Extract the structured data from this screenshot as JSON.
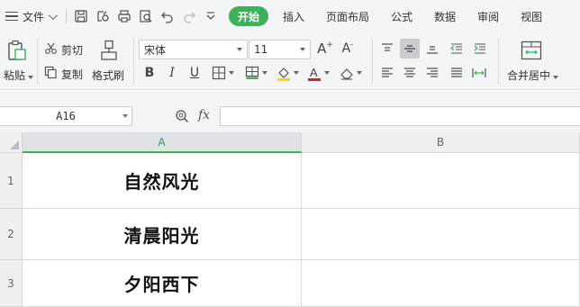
{
  "menu": {
    "file_label": "文件",
    "tabs": [
      "开始",
      "插入",
      "页面布局",
      "公式",
      "数据",
      "审阅",
      "视图"
    ],
    "active_tab": "开始"
  },
  "ribbon": {
    "paste_label": "粘贴",
    "cut_label": "剪切",
    "copy_label": "复制",
    "format_painter_label": "格式刷",
    "font_name": "宋体",
    "font_size": "11",
    "merge_center_label": "合并居中",
    "accent_color": "#3eb05a",
    "font_color": "#e02020",
    "fill_color": "#f5d50a"
  },
  "formula_bar": {
    "name_box": "A16",
    "fx_label": "fx",
    "formula_value": ""
  },
  "sheet": {
    "columns": [
      "A",
      "B"
    ],
    "selected_column": "A",
    "rows": [
      {
        "num": "1",
        "a": "自然风光",
        "b": ""
      },
      {
        "num": "2",
        "a": "清晨阳光",
        "b": ""
      },
      {
        "num": "3",
        "a": "夕阳西下",
        "b": ""
      }
    ]
  }
}
